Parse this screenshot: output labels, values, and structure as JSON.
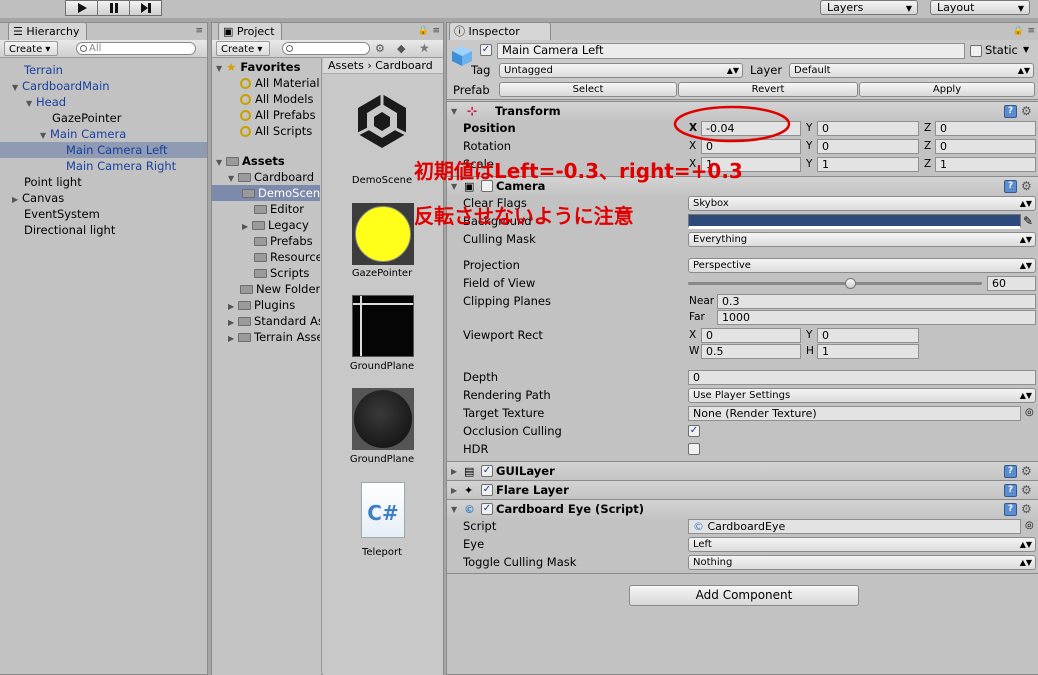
{
  "toolbar": {
    "layers": "Layers",
    "layout": "Layout"
  },
  "hierarchy": {
    "tab": "Hierarchy",
    "create": "Create",
    "search_placeholder": "All",
    "items": [
      {
        "label": "Terrain"
      },
      {
        "label": "CardboardMain"
      },
      {
        "label": "Head"
      },
      {
        "label": "GazePointer"
      },
      {
        "label": "Main Camera"
      },
      {
        "label": "Main Camera Left"
      },
      {
        "label": "Main Camera Right"
      },
      {
        "label": "Point light"
      },
      {
        "label": "Canvas"
      },
      {
        "label": "EventSystem"
      },
      {
        "label": "Directional light"
      }
    ]
  },
  "project": {
    "tab": "Project",
    "create": "Create",
    "favorites_label": "Favorites",
    "favorites": [
      "All Materials",
      "All Models",
      "All Prefabs",
      "All Scripts"
    ],
    "assets_label": "Assets",
    "tree": [
      "Cardboard",
      "DemoScene",
      "Editor",
      "Legacy",
      "Prefabs",
      "Resources",
      "Scripts",
      "New Folder",
      "Plugins",
      "Standard Assets",
      "Terrain Assets"
    ],
    "breadcrumb": [
      "Assets",
      "Cardboard"
    ],
    "assets": [
      "DemoScene",
      "GazePointer",
      "GroundPlane",
      "GroundPlane",
      "Teleport"
    ],
    "cs_glyph": "C#"
  },
  "inspector": {
    "tab": "Inspector",
    "object_name": "Main Camera Left",
    "static_label": "Static",
    "tag_label": "Tag",
    "tag_value": "Untagged",
    "layer_label": "Layer",
    "layer_value": "Default",
    "prefab_label": "Prefab",
    "prefab_select": "Select",
    "prefab_revert": "Revert",
    "prefab_apply": "Apply",
    "transform": {
      "title": "Transform",
      "position_label": "Position",
      "position": {
        "x": "-0.04",
        "y": "0",
        "z": "0"
      },
      "rotation_label": "Rotation",
      "rotation": {
        "x": "0",
        "y": "0",
        "z": "0"
      },
      "scale_label": "Scale",
      "scale": {
        "x": "1",
        "y": "1",
        "z": "1"
      }
    },
    "camera": {
      "title": "Camera",
      "clear_flags_label": "Clear Flags",
      "clear_flags": "Skybox",
      "background_label": "Background",
      "background_color": "#2c4a7c",
      "culling_mask_label": "Culling Mask",
      "culling_mask": "Everything",
      "projection_label": "Projection",
      "projection": "Perspective",
      "fov_label": "Field of View",
      "fov": "60",
      "fov_fraction": 0.55,
      "clipping_label": "Clipping Planes",
      "near_label": "Near",
      "near": "0.3",
      "far_label": "Far",
      "far": "1000",
      "viewport_label": "Viewport Rect",
      "viewport": {
        "x": "0",
        "y": "0",
        "w": "0.5",
        "h": "1"
      },
      "depth_label": "Depth",
      "depth": "0",
      "rendering_path_label": "Rendering Path",
      "rendering_path": "Use Player Settings",
      "target_texture_label": "Target Texture",
      "target_texture": "None (Render Texture)",
      "occlusion_label": "Occlusion Culling",
      "hdr_label": "HDR"
    },
    "guilayer_title": "GUILayer",
    "flare_title": "Flare Layer",
    "cardboard_eye": {
      "title": "Cardboard Eye (Script)",
      "script_label": "Script",
      "script_value": "CardboardEye",
      "eye_label": "Eye",
      "eye_value": "Left",
      "toggle_label": "Toggle Culling Mask",
      "toggle_value": "Nothing"
    },
    "add_component": "Add Component",
    "axis_x": "X",
    "axis_y": "Y",
    "axis_z": "Z",
    "axis_w": "W",
    "axis_h": "H"
  },
  "annotations": {
    "line1": "初期値はLeft=-0.3、right=+0.3",
    "line2": "反転させないように注意",
    "color": "#e10000"
  }
}
